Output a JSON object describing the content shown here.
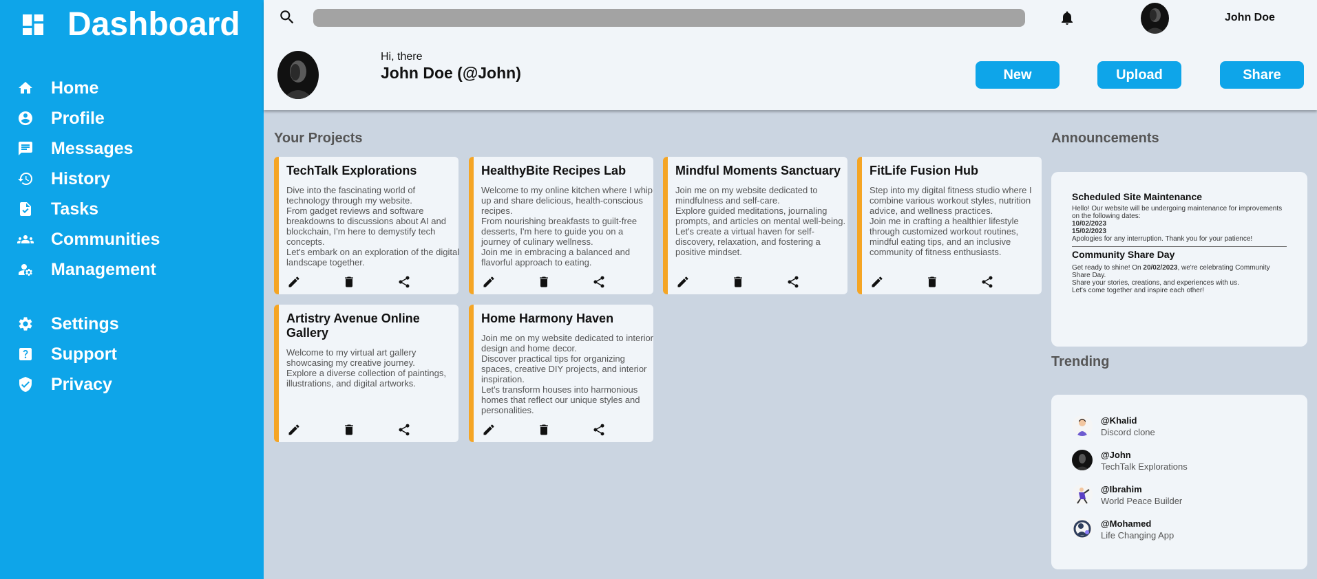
{
  "brand": {
    "title": "Dashboard",
    "icon": "dashboard-grid-icon"
  },
  "sidebar": {
    "items": [
      {
        "label": "Home",
        "icon": "home-icon"
      },
      {
        "label": "Profile",
        "icon": "account-circle-icon"
      },
      {
        "label": "Messages",
        "icon": "message-icon"
      },
      {
        "label": "History",
        "icon": "history-icon"
      },
      {
        "label": "Tasks",
        "icon": "task-icon"
      },
      {
        "label": "Communities",
        "icon": "groups-icon"
      },
      {
        "label": "Management",
        "icon": "manage-accounts-icon"
      },
      {
        "label": "Settings",
        "icon": "gear-icon"
      },
      {
        "label": "Support",
        "icon": "help-icon"
      },
      {
        "label": "Privacy",
        "icon": "shield-icon"
      }
    ]
  },
  "header": {
    "search_placeholder": "",
    "username": "John Doe",
    "greeting": "Hi, there",
    "fullname": "John Doe (@John)",
    "buttons": {
      "new": "New",
      "upload": "Upload",
      "share": "Share"
    }
  },
  "projects": {
    "title": "Your Projects",
    "cards": [
      {
        "title": "TechTalk Explorations",
        "desc": "Dive into the fascinating world of technology through my website.\nFrom gadget reviews and software breakdowns to discussions about AI and blockchain, I'm here to demystify tech concepts.\nLet's embark on an exploration of the digital landscape together."
      },
      {
        "title": "HealthyBite Recipes Lab",
        "desc": "Welcome to my online kitchen where I whip up and share delicious, health-conscious recipes.\nFrom nourishing breakfasts to guilt-free desserts, I'm here to guide you on a journey of culinary wellness.\nJoin me in embracing a balanced and flavorful approach to eating."
      },
      {
        "title": "Mindful Moments Sanctuary",
        "desc": "Join me on my website dedicated to mindfulness and self-care.\nExplore guided meditations, journaling prompts, and articles on mental well-being.\nLet's create a virtual haven for self-discovery, relaxation, and fostering a positive mindset."
      },
      {
        "title": "FitLife Fusion Hub",
        "desc": "Step into my digital fitness studio where I combine various workout styles, nutrition advice, and wellness practices.\nJoin me in crafting a healthier lifestyle through customized workout routines, mindful eating tips, and an inclusive community of fitness enthusiasts."
      },
      {
        "title": "Artistry Avenue Online Gallery",
        "desc": "Welcome to my virtual art gallery showcasing my creative journey.\nExplore a diverse collection of paintings, illustrations, and digital artworks."
      },
      {
        "title": "Home Harmony Haven",
        "desc": "Join me on my website dedicated to interior design and home decor.\nDiscover practical tips for organizing spaces, creative DIY projects, and interior inspiration.\nLet's transform houses into harmonious homes that reflect our unique styles and personalities."
      }
    ]
  },
  "announcements": {
    "title": "Announcements",
    "items": [
      {
        "title": "Scheduled Site Maintenance",
        "intro": "Hello! Our website will be undergoing maintenance for improvements on the following dates:",
        "date1": "10/02/2023",
        "date2": "15/02/2023",
        "outro": "Apologies for any interruption. Thank you for your patience!"
      },
      {
        "title": "Community Share Day",
        "pre": "Get ready to shine! On ",
        "date": "20/02/2023",
        "post": ", we're celebrating Community Share Day.",
        "line2": "Share your stories, creations, and experiences with us.",
        "line3": "Let's come together and inspire each other!"
      }
    ]
  },
  "trending": {
    "title": "Trending",
    "items": [
      {
        "handle": "@Khalid",
        "project": "Discord clone"
      },
      {
        "handle": "@John",
        "project": "TechTalk Explorations"
      },
      {
        "handle": "@Ibrahim",
        "project": "World Peace Builder"
      },
      {
        "handle": "@Mohamed",
        "project": "Life Changing App"
      }
    ]
  },
  "colors": {
    "sidebar": "#0ea5e9",
    "accent": "#f5a524",
    "background": "#cbd5e1",
    "card": "#f1f5f9"
  }
}
